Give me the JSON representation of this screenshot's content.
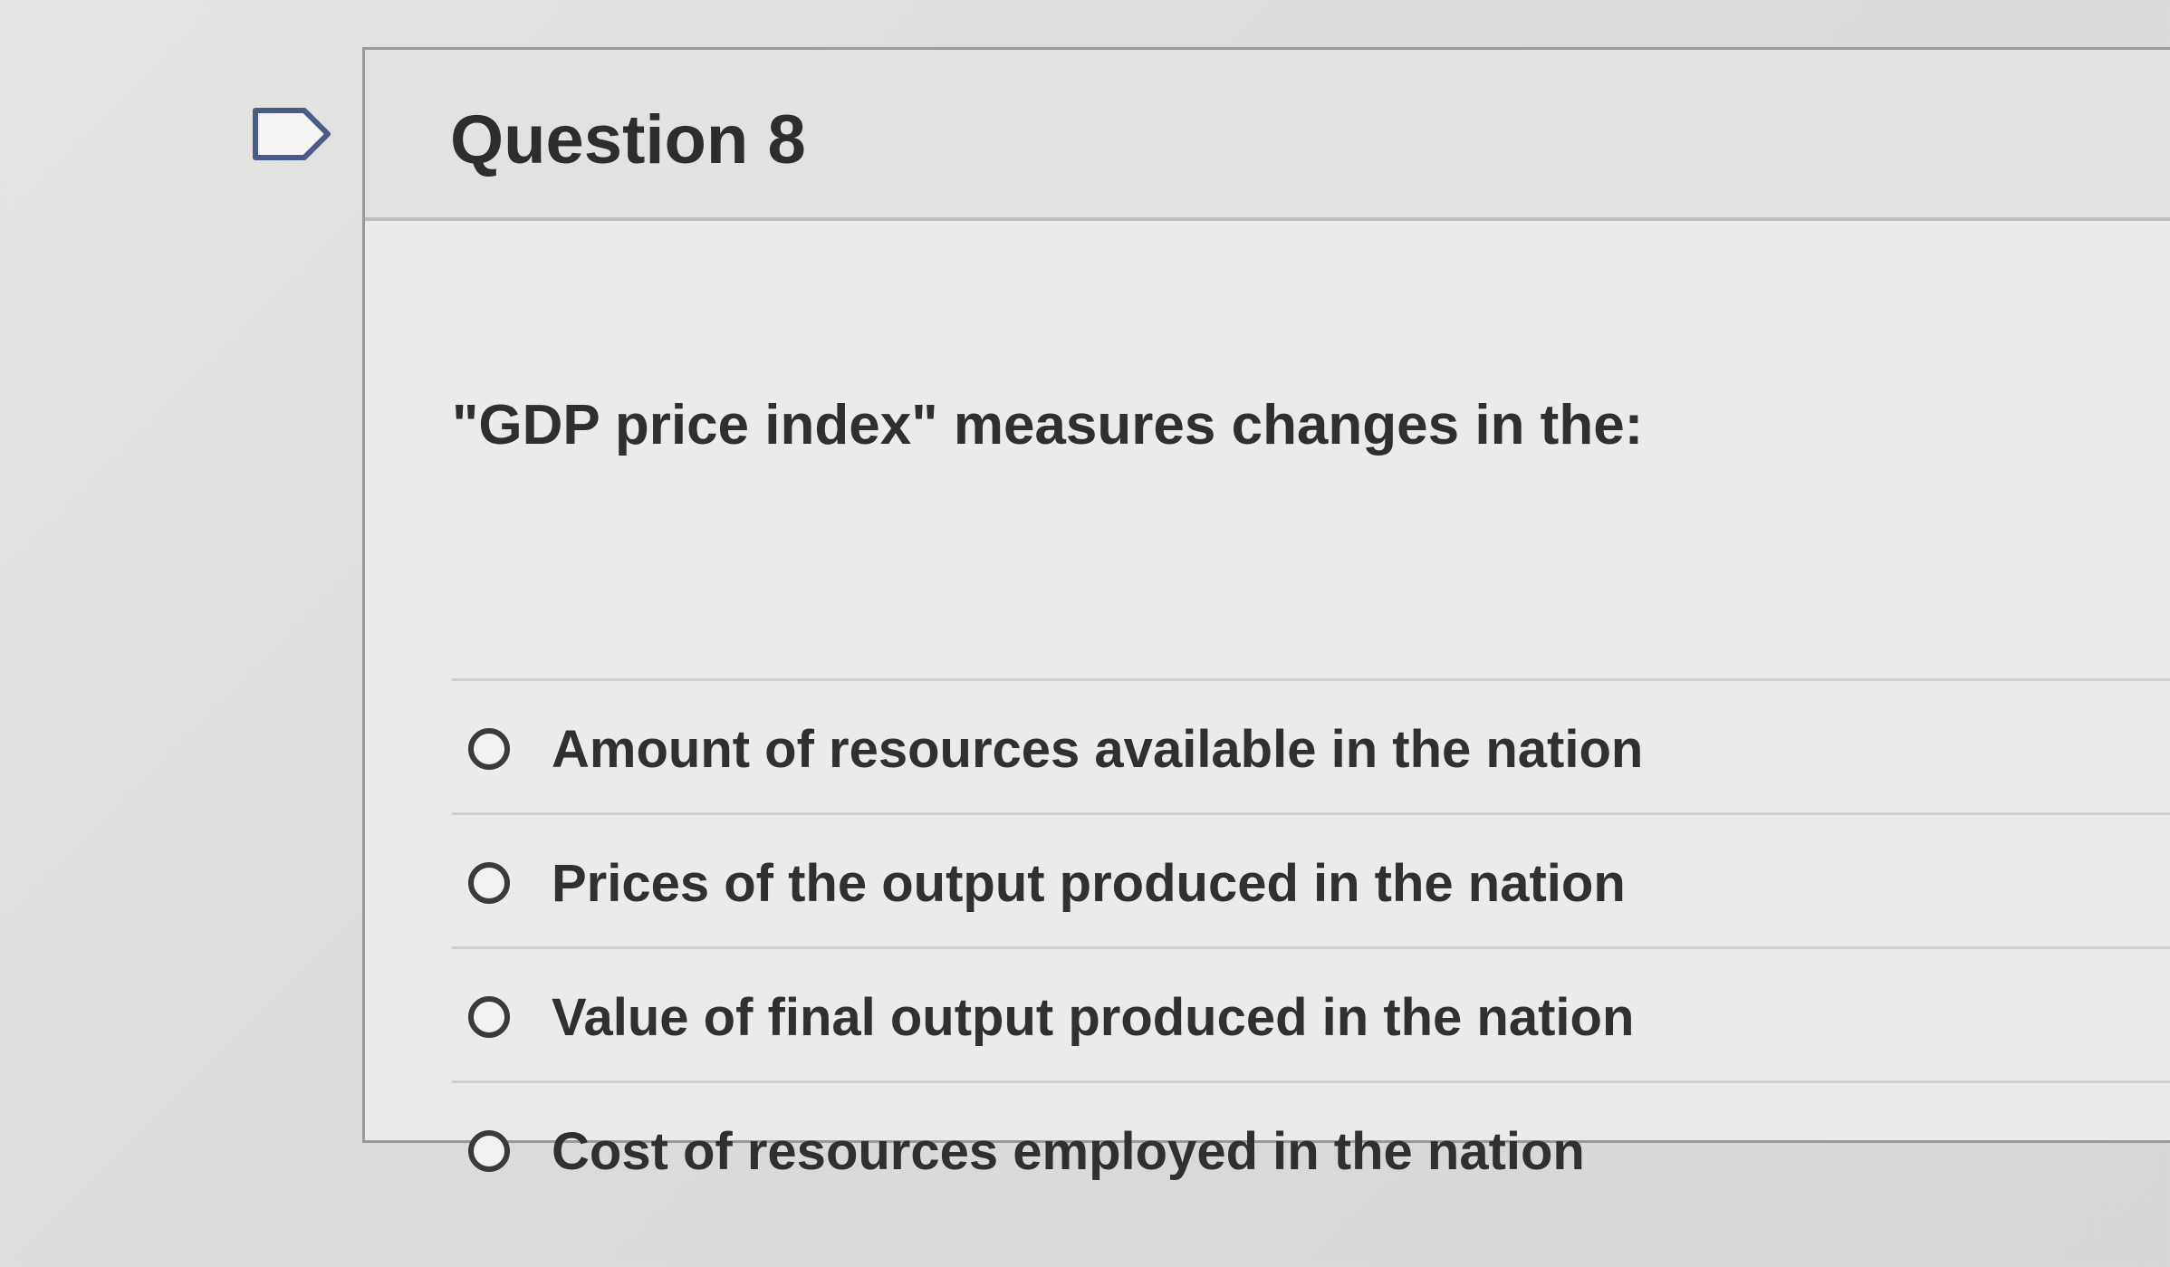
{
  "question": {
    "title": "Question 8",
    "prompt": "\"GDP price index\" measures changes in the:",
    "answers": [
      {
        "label": "Amount of resources available in the nation"
      },
      {
        "label": "Prices of the output produced in the nation"
      },
      {
        "label": "Value of final output produced in the nation"
      },
      {
        "label": "Cost of resources employed in the nation"
      }
    ]
  },
  "icons": {
    "flag": "flag-outline-icon"
  },
  "colors": {
    "card_border": "#9a9a98",
    "header_bg": "#e2e2e0",
    "text": "#2d2d2d"
  }
}
